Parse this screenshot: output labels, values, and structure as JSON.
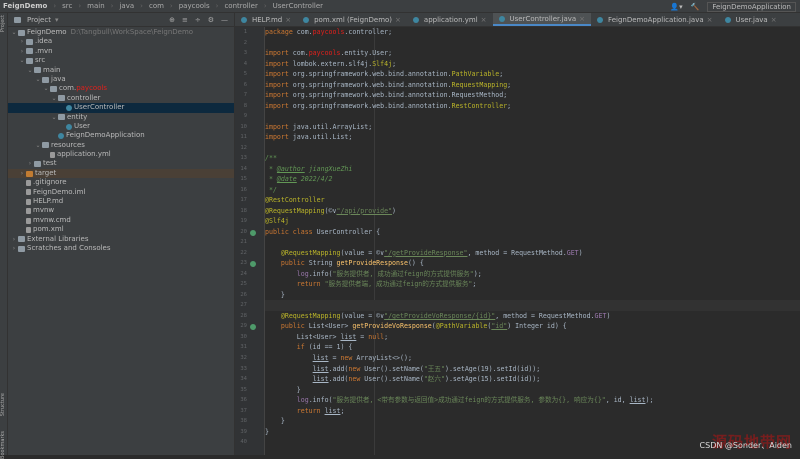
{
  "breadcrumb": [
    "FeignDemo",
    "src",
    "main",
    "java",
    "com",
    "paycools",
    "controller",
    "UserController"
  ],
  "run_config": "FeignDemoApplication",
  "project_panel": {
    "title": "Project",
    "tools": [
      "⊕",
      "≡",
      "÷",
      "⚙",
      "—"
    ],
    "tree": [
      {
        "d": 0,
        "arrow": "v",
        "icon": "fold",
        "label": "FeignDemo",
        "dim": "D:\\Tangbull\\WorkSpace\\FeignDemo"
      },
      {
        "d": 1,
        "arrow": ">",
        "icon": "fold",
        "label": ".idea"
      },
      {
        "d": 1,
        "arrow": ">",
        "icon": "fold",
        "label": ".mvn"
      },
      {
        "d": 1,
        "arrow": "v",
        "icon": "fold",
        "label": "src"
      },
      {
        "d": 2,
        "arrow": "v",
        "icon": "fold",
        "label": "main"
      },
      {
        "d": 3,
        "arrow": "v",
        "icon": "fold",
        "label": "java"
      },
      {
        "d": 4,
        "arrow": "v",
        "icon": "fold",
        "label": "com.",
        "redact": "paycools"
      },
      {
        "d": 5,
        "arrow": "v",
        "icon": "fold",
        "label": "controller"
      },
      {
        "d": 6,
        "arrow": "",
        "icon": "cls",
        "label": "UserController",
        "sel": true
      },
      {
        "d": 5,
        "arrow": "v",
        "icon": "fold",
        "label": "entity"
      },
      {
        "d": 6,
        "arrow": "",
        "icon": "cls",
        "label": "User"
      },
      {
        "d": 5,
        "arrow": "",
        "icon": "cls",
        "label": "FeignDemoApplication"
      },
      {
        "d": 3,
        "arrow": "v",
        "icon": "fold",
        "label": "resources"
      },
      {
        "d": 4,
        "arrow": "",
        "icon": "file",
        "label": "application.yml"
      },
      {
        "d": 2,
        "arrow": ">",
        "icon": "fold",
        "label": "test"
      },
      {
        "d": 1,
        "arrow": ">",
        "icon": "org",
        "label": "target",
        "tgt": true
      },
      {
        "d": 1,
        "arrow": "",
        "icon": "file",
        "label": ".gitignore"
      },
      {
        "d": 1,
        "arrow": "",
        "icon": "file",
        "label": "FeignDemo.iml"
      },
      {
        "d": 1,
        "arrow": "",
        "icon": "file",
        "label": "HELP.md"
      },
      {
        "d": 1,
        "arrow": "",
        "icon": "file",
        "label": "mvnw"
      },
      {
        "d": 1,
        "arrow": "",
        "icon": "file",
        "label": "mvnw.cmd"
      },
      {
        "d": 1,
        "arrow": "",
        "icon": "file",
        "label": "pom.xml"
      },
      {
        "d": 0,
        "arrow": ">",
        "icon": "fold",
        "label": "External Libraries"
      },
      {
        "d": 0,
        "arrow": ">",
        "icon": "fold",
        "label": "Scratches and Consoles"
      }
    ]
  },
  "side_strip": {
    "top": "Project",
    "mid": "Structure",
    "bottom": "Bookmarks"
  },
  "tabs": [
    {
      "label": "HELP.md"
    },
    {
      "label": "pom.xml (FeignDemo)"
    },
    {
      "label": "application.yml"
    },
    {
      "label": "UserController.java",
      "active": true
    },
    {
      "label": "FeignDemoApplication.java"
    },
    {
      "label": "User.java"
    }
  ],
  "code": [
    [
      [
        "k",
        "package "
      ],
      [
        "p",
        "com."
      ],
      [
        "redact",
        "paycools"
      ],
      [
        "p",
        ".controller;"
      ]
    ],
    [],
    [
      [
        "k",
        "import "
      ],
      [
        "p",
        "com."
      ],
      [
        "redact",
        "paycools"
      ],
      [
        "p",
        ".entity.User;"
      ]
    ],
    [
      [
        "k",
        "import "
      ],
      [
        "p",
        "lombok.extern.slf4j."
      ],
      [
        "a",
        "Slf4j"
      ],
      [
        "p",
        ";"
      ]
    ],
    [
      [
        "k",
        "import "
      ],
      [
        "p",
        "org.springframework.web.bind.annotation."
      ],
      [
        "a",
        "PathVariable"
      ],
      [
        "p",
        ";"
      ]
    ],
    [
      [
        "k",
        "import "
      ],
      [
        "p",
        "org.springframework.web.bind.annotation."
      ],
      [
        "a",
        "RequestMapping"
      ],
      [
        "p",
        ";"
      ]
    ],
    [
      [
        "k",
        "import "
      ],
      [
        "p",
        "org.springframework.web.bind.annotation.RequestMethod;"
      ]
    ],
    [
      [
        "k",
        "import "
      ],
      [
        "p",
        "org.springframework.web.bind.annotation."
      ],
      [
        "a",
        "RestController"
      ],
      [
        "p",
        ";"
      ]
    ],
    [],
    [
      [
        "k",
        "import "
      ],
      [
        "p",
        "java.util.ArrayList;"
      ]
    ],
    [
      [
        "k",
        "import "
      ],
      [
        "p",
        "java.util.List;"
      ]
    ],
    [],
    [
      [
        "c",
        "/**"
      ]
    ],
    [
      [
        "c",
        " * "
      ],
      [
        "ct",
        "@author"
      ],
      [
        "c",
        " jiangXueZhi"
      ]
    ],
    [
      [
        "c",
        " * "
      ],
      [
        "ct",
        "@date"
      ],
      [
        "c",
        " 2022/4/2"
      ]
    ],
    [
      [
        "c",
        " */"
      ]
    ],
    [
      [
        "a",
        "@RestController"
      ]
    ],
    [
      [
        "a",
        "@RequestMapping"
      ],
      [
        "p",
        "(©∨"
      ],
      [
        "u",
        "\"/api/provide\""
      ],
      [
        "p",
        ")"
      ]
    ],
    [
      [
        "a",
        "@Slf4j"
      ]
    ],
    [
      [
        "k",
        "public class "
      ],
      [
        "p",
        "UserController {"
      ]
    ],
    [],
    [
      [
        "p",
        "    "
      ],
      [
        "a",
        "@RequestMapping"
      ],
      [
        "p",
        "(value = ©∨"
      ],
      [
        "u",
        "\"/getProvideResponse\""
      ],
      [
        "p",
        ", method = RequestMethod."
      ],
      [
        "f",
        "GET"
      ],
      [
        "p",
        ")"
      ]
    ],
    [
      [
        "p",
        "    "
      ],
      [
        "k",
        "public "
      ],
      [
        "p",
        "String "
      ],
      [
        "m",
        "getProvideResponse"
      ],
      [
        "p",
        "() {"
      ]
    ],
    [
      [
        "p",
        "        "
      ],
      [
        "f",
        "log"
      ],
      [
        "p",
        ".info("
      ],
      [
        "s",
        "\"服务提供者, 成功通过feign的方式提供服务\""
      ],
      [
        "p",
        ");"
      ]
    ],
    [
      [
        "p",
        "        "
      ],
      [
        "k",
        "return "
      ],
      [
        "s",
        "\"服务提供者端, 成功通过feign的方式提供服务\""
      ],
      [
        "p",
        ";"
      ]
    ],
    [
      [
        "p",
        "    }"
      ]
    ],
    [],
    [
      [
        "p",
        "    "
      ],
      [
        "a",
        "@RequestMapping"
      ],
      [
        "p",
        "(value = ©∨"
      ],
      [
        "u",
        "\"/getProvideVoResponse/{id}\""
      ],
      [
        "p",
        ", method = RequestMethod."
      ],
      [
        "f",
        "GET"
      ],
      [
        "p",
        ")"
      ]
    ],
    [
      [
        "p",
        "    "
      ],
      [
        "k",
        "public "
      ],
      [
        "p",
        "List<User> "
      ],
      [
        "m",
        "getProvideVoResponse"
      ],
      [
        "p",
        "("
      ],
      [
        "a",
        "@PathVariable"
      ],
      [
        "p",
        "("
      ],
      [
        "u",
        "\"id\""
      ],
      [
        "p",
        ") Integer id) {"
      ]
    ],
    [
      [
        "p",
        "        List<User> "
      ],
      [
        "pu",
        "list"
      ],
      [
        "p",
        " = "
      ],
      [
        "k",
        "null"
      ],
      [
        "p",
        ";"
      ]
    ],
    [
      [
        "p",
        "        "
      ],
      [
        "k",
        "if "
      ],
      [
        "p",
        "(id == 1) {"
      ]
    ],
    [
      [
        "p",
        "            "
      ],
      [
        "pu",
        "list"
      ],
      [
        "p",
        " = "
      ],
      [
        "k",
        "new "
      ],
      [
        "p",
        "ArrayList<>();"
      ]
    ],
    [
      [
        "p",
        "            "
      ],
      [
        "pu",
        "list"
      ],
      [
        "p",
        ".add("
      ],
      [
        "k",
        "new "
      ],
      [
        "p",
        "User().setName("
      ],
      [
        "s",
        "\"王五\""
      ],
      [
        "p",
        ").setAge(19).setId(id));"
      ]
    ],
    [
      [
        "p",
        "            "
      ],
      [
        "pu",
        "list"
      ],
      [
        "p",
        ".add("
      ],
      [
        "k",
        "new "
      ],
      [
        "p",
        "User().setName("
      ],
      [
        "s",
        "\"赵六\""
      ],
      [
        "p",
        ").setAge(15).setId(id));"
      ]
    ],
    [
      [
        "p",
        "        }"
      ]
    ],
    [
      [
        "p",
        "        "
      ],
      [
        "f",
        "log"
      ],
      [
        "p",
        ".info("
      ],
      [
        "s",
        "\"服务提供者, <带有参数与返回值>成功通过feign的方式提供服务, 参数为{}, 响应为{}\""
      ],
      [
        "p",
        ", id, "
      ],
      [
        "pu",
        "list"
      ],
      [
        "p",
        ");"
      ]
    ],
    [
      [
        "p",
        "        "
      ],
      [
        "k",
        "return "
      ],
      [
        "pu",
        "list"
      ],
      [
        "p",
        ";"
      ]
    ],
    [
      [
        "p",
        "    }"
      ]
    ],
    [
      [
        "p",
        "}"
      ]
    ],
    []
  ],
  "gutter_icons": [
    20,
    23,
    29
  ],
  "current_line": 27,
  "watermark": {
    "text": "CSDN @Sonder、Aiden",
    "stamp": "源码地带网"
  }
}
